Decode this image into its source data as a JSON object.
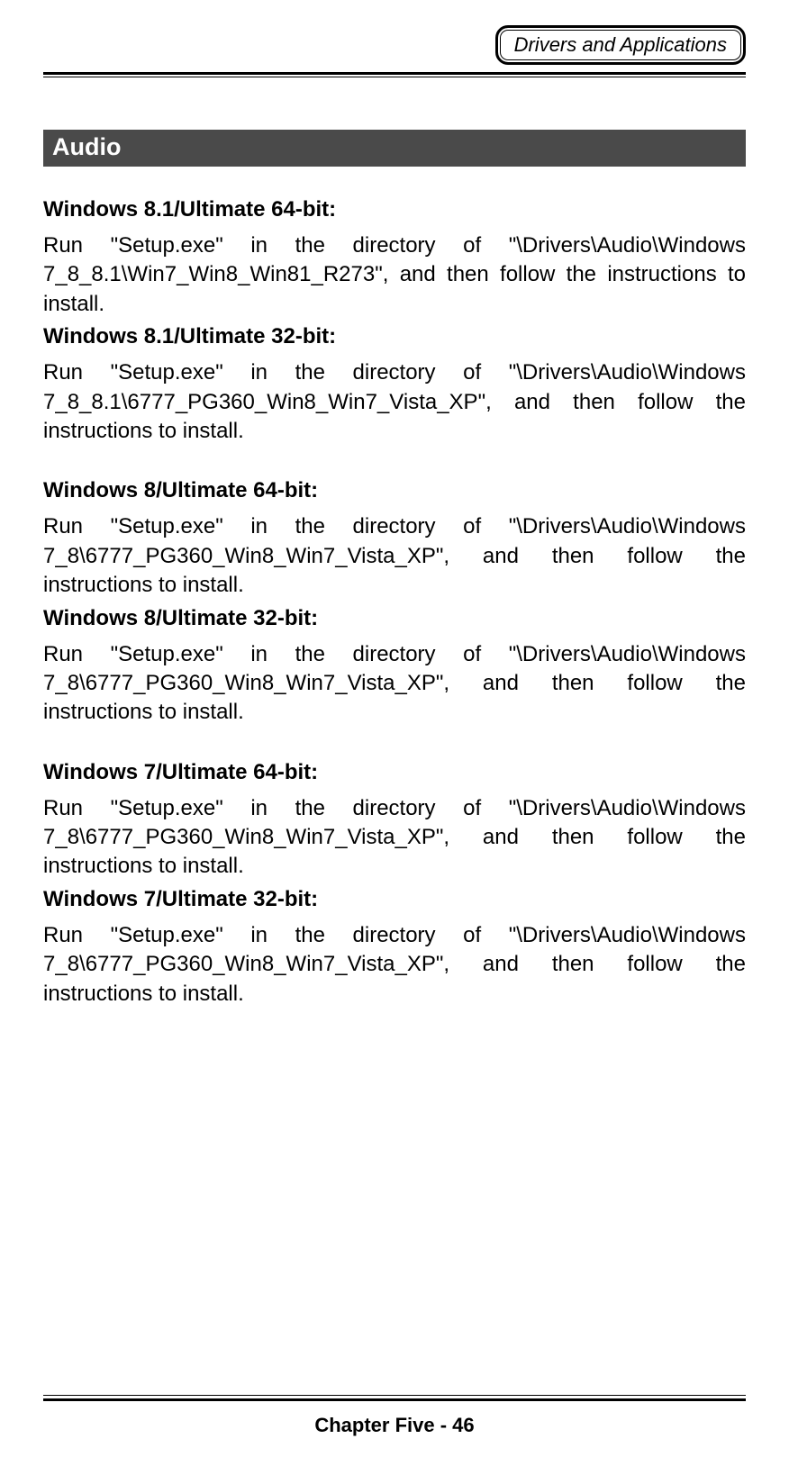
{
  "header": {
    "badge": "Drivers and Applications"
  },
  "section": {
    "title": " Audio"
  },
  "blocks": [
    {
      "type": "subhead",
      "text": "Windows 8.1/Ultimate 64-bit:"
    },
    {
      "type": "body",
      "text": "Run \"Setup.exe\" in the directory of \"\\Drivers\\Audio\\Windows 7_8_8.1\\Win7_Win8_Win81_R273\", and then follow the instructions to install."
    },
    {
      "type": "subhead",
      "text": "Windows 8.1/Ultimate 32-bit:"
    },
    {
      "type": "body",
      "text": "Run \"Setup.exe\" in the directory of \"\\Drivers\\Audio\\Windows 7_8_8.1\\6777_PG360_Win8_Win7_Vista_XP\", and then follow the instructions to install."
    },
    {
      "type": "gap-med"
    },
    {
      "type": "subhead",
      "text": "Windows 8/Ultimate 64-bit:"
    },
    {
      "type": "body",
      "text": "Run \"Setup.exe\" in the directory of \"\\Drivers\\Audio\\Windows 7_8\\6777_PG360_Win8_Win7_Vista_XP\", and then follow the instructions to install."
    },
    {
      "type": "subhead",
      "text": "Windows 8/Ultimate 32-bit:"
    },
    {
      "type": "body",
      "text": "Run \"Setup.exe\" in the directory of \"\\Drivers\\Audio\\Windows 7_8\\6777_PG360_Win8_Win7_Vista_XP\", and then follow the instructions to install."
    },
    {
      "type": "gap-med"
    },
    {
      "type": "subhead",
      "text": "Windows 7/Ultimate 64-bit:"
    },
    {
      "type": "body",
      "text": "Run \"Setup.exe\" in the directory of \"\\Drivers\\Audio\\Windows 7_8\\6777_PG360_Win8_Win7_Vista_XP\", and then follow the instructions to install."
    },
    {
      "type": "subhead",
      "text": "Windows 7/Ultimate 32-bit:"
    },
    {
      "type": "body",
      "text": "Run \"Setup.exe\" in the directory of \"\\Drivers\\Audio\\Windows 7_8\\6777_PG360_Win8_Win7_Vista_XP\", and then follow the instructions to install."
    }
  ],
  "footer": {
    "text": "Chapter Five - 46"
  }
}
